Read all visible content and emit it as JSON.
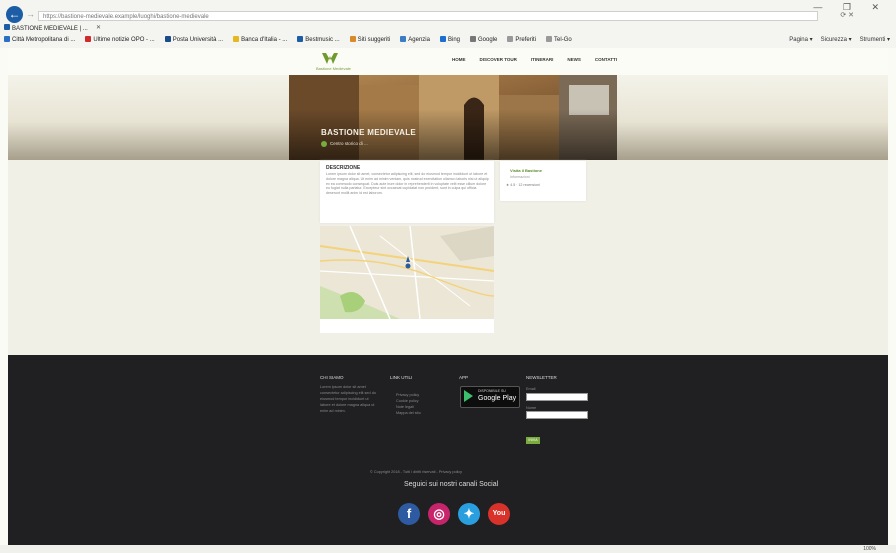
{
  "browser": {
    "address": "https://bastione-medievale.example/luoghi/bastione-medievale",
    "tab_title": "BASTIONE MEDIEVALE | ...",
    "window_controls": "— ❐ ✕",
    "favorites": [
      {
        "label": "Città Metropolitana di ...",
        "color": "#2a6fc4"
      },
      {
        "label": "Ultime notizie OPO - ...",
        "color": "#d12a2a"
      },
      {
        "label": "Posta Università ...",
        "color": "#1a4c8a"
      },
      {
        "label": "Banca d'Italia - ...",
        "color": "#e6b820"
      },
      {
        "label": "Bestmusic ...",
        "color": "#1c5da6"
      },
      {
        "label": "Siti suggeriti",
        "color": "#d98a2a"
      },
      {
        "label": "Agenzia",
        "color": "#3b7dc4"
      },
      {
        "label": "Bing",
        "color": "#1a6fd0"
      },
      {
        "label": "Google",
        "color": "#777777"
      },
      {
        "label": "Preferiti",
        "color": "#999999"
      },
      {
        "label": "Tel-Go",
        "color": "#999999"
      }
    ],
    "command_bar": [
      "Pagina ▾",
      "Sicurezza ▾",
      "Strumenti ▾"
    ],
    "zoom": "100%"
  },
  "site": {
    "logo_text": "Bastione Medievale",
    "nav": [
      "HOME",
      "DISCOVER TOUR",
      "ITINERARI",
      "NEWS",
      "CONTATTI"
    ],
    "hero_title": "BASTIONE MEDIEVALE",
    "hero_subtitle": "Centro storico di ...",
    "card_title": "DESCRIZIONE",
    "card_text": "Lorem ipsum dolor sit amet, consectetur adipiscing elit, sed do eiusmod tempor incididunt ut labore et dolore magna aliqua. Ut enim ad minim veniam, quis nostrud exercitation ullamco laboris nisi ut aliquip ex ea commodo consequat. Duis aute irure dolor in reprehenderit in voluptate velit esse cillum dolore eu fugiat nulla pariatur. Excepteur sint occaecat cupidatat non proident, sunt in culpa qui officia deserunt mollit anim id est laborum.",
    "side_title": "Visita il Bastione",
    "side_sub": "Informazioni",
    "side_meta": "★ 4.5 · 12 recensioni",
    "accent": "#7aab3e"
  },
  "footer": {
    "col1_title": "CHI SIAMO",
    "col1_text": "Lorem ipsum dolor sit amet consectetur adipiscing elit sed do eiusmod tempor incididunt ut labore et dolore magna aliqua ut enim ad minim.",
    "col2_title": "LINK UTILI",
    "col2_items": [
      "Privacy policy",
      "Cookie policy",
      "Note legali",
      "Mappa del sito"
    ],
    "col3_title": "APP",
    "gp_small": "DISPONIBILE SU",
    "gp_big": "Google Play",
    "col4_title": "NEWSLETTER",
    "email_label": "Email",
    "name_label": "Nome",
    "submit": "INVIA",
    "copyright": "© Copyright 2018 - Tutti i diritti riservati - Privacy policy",
    "follow": "Seguici sui nostri canali Social",
    "social": [
      {
        "name": "facebook",
        "glyph": "f",
        "color": "#2d5aa0"
      },
      {
        "name": "instagram",
        "glyph": "◎",
        "color": "#c8246b"
      },
      {
        "name": "twitter",
        "glyph": "✦",
        "color": "#2a9fe0"
      },
      {
        "name": "youtube",
        "glyph": "You",
        "color": "#d8322a"
      }
    ]
  }
}
